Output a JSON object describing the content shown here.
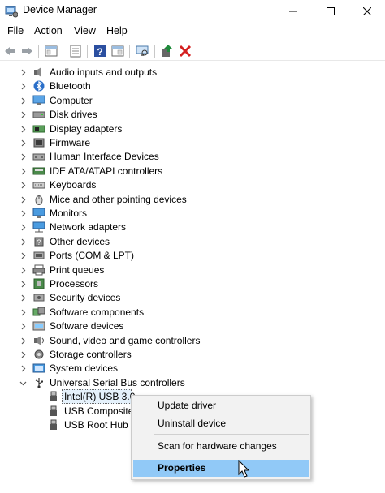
{
  "window": {
    "title": "Device Manager",
    "controls": {
      "minimize": "minimize",
      "maximize": "maximize",
      "close": "close"
    }
  },
  "menu": [
    "File",
    "Action",
    "View",
    "Help"
  ],
  "toolbar": {
    "icons": [
      "back-arrow-icon",
      "forward-arrow-icon",
      "show-hide-tree-icon",
      "properties-sheet-icon",
      "help-icon",
      "view-list-icon",
      "scan-hardware-icon",
      "update-driver-icon",
      "uninstall-device-icon"
    ]
  },
  "tree": {
    "categories": [
      {
        "label": "Audio inputs and outputs",
        "icon": "speaker-icon"
      },
      {
        "label": "Bluetooth",
        "icon": "bluetooth-icon"
      },
      {
        "label": "Computer",
        "icon": "computer-icon"
      },
      {
        "label": "Disk drives",
        "icon": "disk-drive-icon"
      },
      {
        "label": "Display adapters",
        "icon": "display-adapter-icon"
      },
      {
        "label": "Firmware",
        "icon": "firmware-icon"
      },
      {
        "label": "Human Interface Devices",
        "icon": "hid-icon"
      },
      {
        "label": "IDE ATA/ATAPI controllers",
        "icon": "ide-controller-icon"
      },
      {
        "label": "Keyboards",
        "icon": "keyboard-icon"
      },
      {
        "label": "Mice and other pointing devices",
        "icon": "mouse-icon"
      },
      {
        "label": "Monitors",
        "icon": "monitor-icon"
      },
      {
        "label": "Network adapters",
        "icon": "network-adapter-icon"
      },
      {
        "label": "Other devices",
        "icon": "unknown-device-icon"
      },
      {
        "label": "Ports (COM & LPT)",
        "icon": "port-icon"
      },
      {
        "label": "Print queues",
        "icon": "printer-icon"
      },
      {
        "label": "Processors",
        "icon": "processor-icon"
      },
      {
        "label": "Security devices",
        "icon": "security-device-icon"
      },
      {
        "label": "Software components",
        "icon": "software-component-icon"
      },
      {
        "label": "Software devices",
        "icon": "software-device-icon"
      },
      {
        "label": "Sound, video and game controllers",
        "icon": "sound-controller-icon"
      },
      {
        "label": "Storage controllers",
        "icon": "storage-controller-icon"
      },
      {
        "label": "System devices",
        "icon": "system-device-icon"
      },
      {
        "label": "Universal Serial Bus controllers",
        "icon": "usb-icon",
        "expanded": true
      }
    ],
    "usb_children": [
      {
        "label": "Intel(R) USB 3.0",
        "icon": "usb-plug-icon",
        "selected": true
      },
      {
        "label": "USB Composite",
        "icon": "usb-plug-icon"
      },
      {
        "label": "USB Root Hub (",
        "icon": "usb-plug-icon"
      }
    ]
  },
  "context_menu": {
    "update_driver": "Update driver",
    "uninstall_device": "Uninstall device",
    "scan": "Scan for hardware changes",
    "properties": "Properties"
  },
  "colors": {
    "accent_highlight": "#91c9f7",
    "selection": "#e5f1fb",
    "uninstall_red": "#d42020",
    "update_green": "#1e8a3a"
  }
}
